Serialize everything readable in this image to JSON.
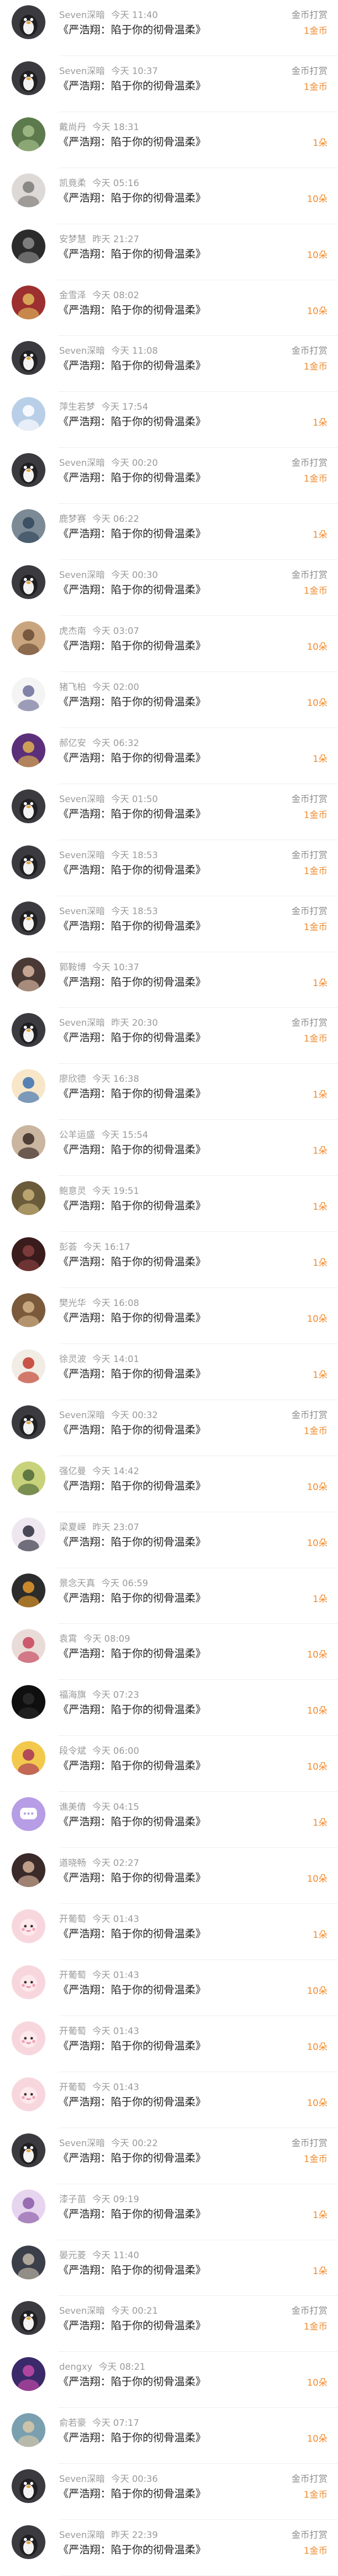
{
  "title_text": "《严浩翔：陷于你的彻骨温柔》",
  "label_coin": "金币打赏",
  "rows": [
    {
      "name": "Seven深暗",
      "time": "今天 11:40",
      "reward": "1金币",
      "coin": true,
      "avatar": "penguin"
    },
    {
      "name": "Seven深暗",
      "time": "今天 10:37",
      "reward": "1金币",
      "coin": true,
      "avatar": "penguin"
    },
    {
      "name": "戴尚丹",
      "time": "今天 18:31",
      "reward": "1朵",
      "coin": false,
      "avatar": "green"
    },
    {
      "name": "凯竟柔",
      "time": "今天 05:16",
      "reward": "10朵",
      "coin": false,
      "avatar": "pale"
    },
    {
      "name": "安梦慧",
      "time": "昨天 21:27",
      "reward": "10朵",
      "coin": false,
      "avatar": "dark"
    },
    {
      "name": "金雪泽",
      "time": "今天 08:02",
      "reward": "10朵",
      "coin": false,
      "avatar": "red"
    },
    {
      "name": "Seven深暗",
      "time": "今天 11:08",
      "reward": "1金币",
      "coin": true,
      "avatar": "penguin"
    },
    {
      "name": "萍生若梦",
      "time": "今天 17:54",
      "reward": "1朵",
      "coin": false,
      "avatar": "sky"
    },
    {
      "name": "Seven深暗",
      "time": "今天 00:20",
      "reward": "1金币",
      "coin": true,
      "avatar": "penguin"
    },
    {
      "name": "鹿梦赛",
      "time": "今天 06:22",
      "reward": "1朵",
      "coin": false,
      "avatar": "eye"
    },
    {
      "name": "Seven深暗",
      "time": "今天 00:30",
      "reward": "1金币",
      "coin": true,
      "avatar": "penguin"
    },
    {
      "name": "虎杰南",
      "time": "今天 03:07",
      "reward": "10朵",
      "coin": false,
      "avatar": "tan"
    },
    {
      "name": "猪飞柏",
      "time": "今天 02:00",
      "reward": "10朵",
      "coin": false,
      "avatar": "white"
    },
    {
      "name": "郝亿安",
      "time": "今天 06:32",
      "reward": "1朵",
      "coin": false,
      "avatar": "purple"
    },
    {
      "name": "Seven深暗",
      "time": "今天 01:50",
      "reward": "1金币",
      "coin": true,
      "avatar": "penguin"
    },
    {
      "name": "Seven深暗",
      "time": "今天 18:53",
      "reward": "1金币",
      "coin": true,
      "avatar": "penguin"
    },
    {
      "name": "Seven深暗",
      "time": "今天 18:53",
      "reward": "1金币",
      "coin": true,
      "avatar": "penguin"
    },
    {
      "name": "郭鞍博",
      "time": "今天 10:37",
      "reward": "1朵",
      "coin": false,
      "avatar": "portrait"
    },
    {
      "name": "Seven深暗",
      "time": "昨天 20:30",
      "reward": "1金币",
      "coin": true,
      "avatar": "penguin"
    },
    {
      "name": "廖欣德",
      "time": "今天 16:38",
      "reward": "1朵",
      "coin": false,
      "avatar": "cartoon"
    },
    {
      "name": "公羊运盛",
      "time": "今天 15:54",
      "reward": "1朵",
      "coin": false,
      "avatar": "girl"
    },
    {
      "name": "鲍意灵",
      "time": "今天 19:51",
      "reward": "1朵",
      "coin": false,
      "avatar": "olive"
    },
    {
      "name": "彭荟",
      "time": "今天 16:17",
      "reward": "1朵",
      "coin": false,
      "avatar": "maroon"
    },
    {
      "name": "樊光华",
      "time": "今天 16:08",
      "reward": "10朵",
      "coin": false,
      "avatar": "brown"
    },
    {
      "name": "徐灵波",
      "time": "今天 14:01",
      "reward": "1朵",
      "coin": false,
      "avatar": "poster"
    },
    {
      "name": "Seven深暗",
      "time": "今天 00:32",
      "reward": "1金币",
      "coin": true,
      "avatar": "penguin"
    },
    {
      "name": "强亿曼",
      "time": "今天 14:42",
      "reward": "10朵",
      "coin": false,
      "avatar": "yellowgreen"
    },
    {
      "name": "梁夏嵘",
      "time": "昨天 23:07",
      "reward": "10朵",
      "coin": false,
      "avatar": "anime"
    },
    {
      "name": "景念天真",
      "time": "今天 06:59",
      "reward": "1朵",
      "coin": false,
      "avatar": "orange"
    },
    {
      "name": "袁霄",
      "time": "今天 08:09",
      "reward": "10朵",
      "coin": false,
      "avatar": "pinkhat"
    },
    {
      "name": "福海旗",
      "time": "今天 07:23",
      "reward": "10朵",
      "coin": false,
      "avatar": "black"
    },
    {
      "name": "段令斌",
      "time": "今天 06:00",
      "reward": "10朵",
      "coin": false,
      "avatar": "cartoon2"
    },
    {
      "name": "谯美倩",
      "time": "今天 04:15",
      "reward": "1朵",
      "coin": false,
      "avatar": "chat"
    },
    {
      "name": "道晓畅",
      "time": "今天 02:27",
      "reward": "10朵",
      "coin": false,
      "avatar": "woman"
    },
    {
      "name": "开葡萄",
      "time": "今天 01:43",
      "reward": "1朵",
      "coin": false,
      "avatar": "pinkface"
    },
    {
      "name": "开葡萄",
      "time": "今天 01:43",
      "reward": "10朵",
      "coin": false,
      "avatar": "pinkface"
    },
    {
      "name": "开葡萄",
      "time": "今天 01:43",
      "reward": "10朵",
      "coin": false,
      "avatar": "pinkface"
    },
    {
      "name": "开葡萄",
      "time": "今天 01:43",
      "reward": "10朵",
      "coin": false,
      "avatar": "pinkface"
    },
    {
      "name": "Seven深暗",
      "time": "今天 00:22",
      "reward": "1金币",
      "coin": true,
      "avatar": "penguin"
    },
    {
      "name": "漆子苗",
      "time": "今天 09:19",
      "reward": "1朵",
      "coin": false,
      "avatar": "lilac"
    },
    {
      "name": "晏元菱",
      "time": "今天 11:40",
      "reward": "1朵",
      "coin": false,
      "avatar": "stage"
    },
    {
      "name": "Seven深暗",
      "time": "今天 00:21",
      "reward": "1金币",
      "coin": true,
      "avatar": "penguin"
    },
    {
      "name": "dengxy",
      "time": "今天 08:21",
      "reward": "10朵",
      "coin": false,
      "avatar": "purple2"
    },
    {
      "name": "俞若豪",
      "time": "今天 07:17",
      "reward": "10朵",
      "coin": false,
      "avatar": "photo"
    },
    {
      "name": "Seven深暗",
      "time": "今天 00:36",
      "reward": "1金币",
      "coin": true,
      "avatar": "penguin"
    },
    {
      "name": "Seven深暗",
      "time": "昨天 22:39",
      "reward": "1金币",
      "coin": true,
      "avatar": "penguin"
    }
  ]
}
